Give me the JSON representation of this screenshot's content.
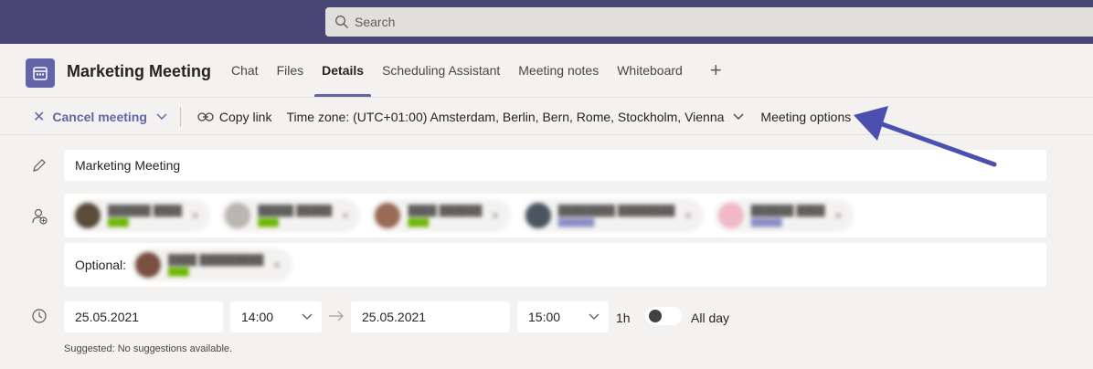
{
  "search": {
    "placeholder": "Search"
  },
  "header": {
    "title": "Marketing Meeting",
    "tabs": [
      {
        "label": "Chat"
      },
      {
        "label": "Files"
      },
      {
        "label": "Details"
      },
      {
        "label": "Scheduling Assistant"
      },
      {
        "label": "Meeting notes"
      },
      {
        "label": "Whiteboard"
      }
    ],
    "active_tab": "Details"
  },
  "toolbar": {
    "cancel_label": "Cancel meeting",
    "copy_link_label": "Copy link",
    "timezone_label": "Time zone: (UTC+01:00) Amsterdam, Berlin, Bern, Rome, Stockholm, Vienna",
    "meeting_options_label": "Meeting options"
  },
  "form": {
    "title_value": "Marketing Meeting",
    "optional_label": "Optional:",
    "start_date": "25.05.2021",
    "start_time": "14:00",
    "end_date": "25.05.2021",
    "end_time": "15:00",
    "duration": "1h",
    "all_day_label": "All day",
    "all_day_on": false,
    "suggested": "Suggested: No suggestions available."
  },
  "colors": {
    "topbar": "#464775",
    "accent": "#6264a7",
    "annotation_arrow": "#4b4fb0"
  }
}
